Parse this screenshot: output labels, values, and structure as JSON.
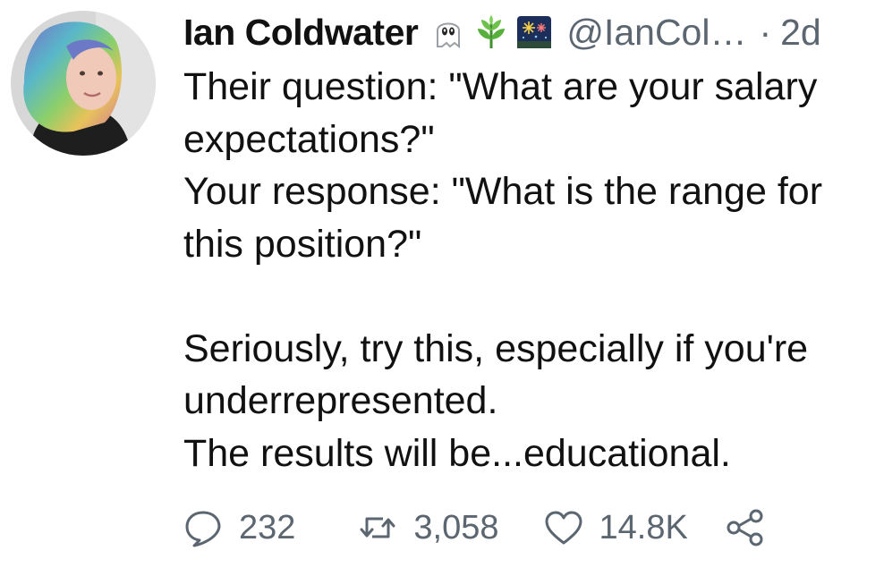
{
  "author": {
    "name": "Ian Coldwater",
    "handle": "@IanCol…",
    "separator": "·",
    "time": "2d",
    "emojis": [
      "ghost-emoji",
      "herb-emoji",
      "fireworks-emoji"
    ]
  },
  "tweet": {
    "lines": [
      "Their question: \"What are your salary",
      "expectations?\"",
      "Your response: \"What is the range for",
      "this position?\"",
      "",
      "Seriously, try this, especially if you're",
      "underrepresented.",
      "The results will be...educational."
    ]
  },
  "actions": {
    "reply_count": "232",
    "retweet_count": "3,058",
    "like_count": "14.8K"
  },
  "colors": {
    "text": "#111111",
    "muted": "#5b6670",
    "background": "#ffffff"
  }
}
